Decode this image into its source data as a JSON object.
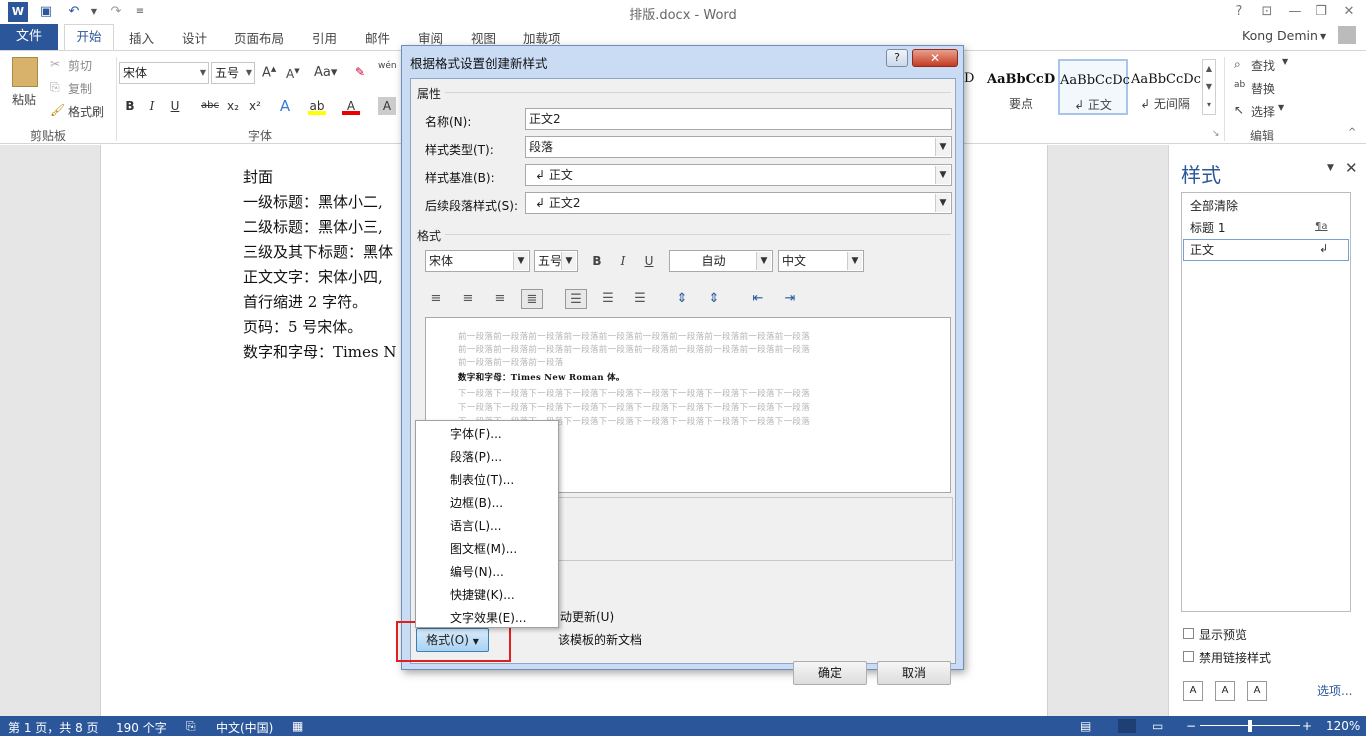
{
  "window": {
    "title": "排版.docx - Word",
    "user": "Kong Demin",
    "qat_undo": "↶",
    "qat_redo": "↷"
  },
  "tabs": [
    "文件",
    "开始",
    "插入",
    "设计",
    "页面布局",
    "引用",
    "邮件",
    "审阅",
    "视图",
    "加载项"
  ],
  "ribbon": {
    "clipboard": {
      "paste": "粘贴",
      "cut": "剪切",
      "copy": "复制",
      "format_painter": "格式刷",
      "group": "剪贴板"
    },
    "font": {
      "font_name": "宋体",
      "font_size": "五号",
      "group": "字体",
      "bold": "B",
      "italic": "I",
      "underline": "U",
      "strike": "abc",
      "sub": "x₂",
      "sup": "x²"
    },
    "styles": [
      {
        "preview": "AaBbCcD",
        "name": "要点"
      },
      {
        "preview": "AaBbCcDc",
        "name": "↲ 正文"
      },
      {
        "preview": "AaBbCcDc",
        "name": "↲ 无间隔"
      }
    ],
    "editing": {
      "find": "查找",
      "replace": "替换",
      "select": "选择",
      "group": "编辑"
    }
  },
  "document": {
    "lines": [
      "封面",
      "一级标题：黑体小二,",
      "二级标题：黑体小三,",
      "三级及其下标题：黑体",
      "正文文字：宋体小四,",
      "首行缩进 2 字符。",
      "页码：5 号宋体。",
      "数字和字母：Times N"
    ]
  },
  "styles_pane": {
    "title": "样式",
    "items": [
      "全部清除",
      "标题 1",
      "正文"
    ],
    "show_preview": "显示预览",
    "disable_linked": "禁用链接样式",
    "options": "选项..."
  },
  "status": {
    "page": "第 1 页，共 8 页",
    "words": "190 个字",
    "lang": "中文(中国)",
    "zoom": "120%"
  },
  "dialog": {
    "title": "根据格式设置创建新样式",
    "properties_label": "属性",
    "name_label": "名称(N):",
    "name_value": "正文2",
    "type_label": "样式类型(T):",
    "type_value": "段落",
    "based_label": "样式基准(B):",
    "based_value": "↲ 正文",
    "next_label": "后续段落样式(S):",
    "next_value": "↲ 正文2",
    "format_label": "格式",
    "font_value": "宋体",
    "size_value": "五号",
    "color_value": "自动",
    "lang_value": "中文",
    "preview_prev": "前一段落前一段落前一段落前一段落前一段落前一段落前一段落前一段落前一段落前一段落",
    "preview_prev_short": "前一段落前一段落前一段落",
    "preview_current": "数字和字母：Times New Roman 体。",
    "preview_next": "下一段落下一段落下一段落下一段落下一段落下一段落下一段落下一段落下一段落下一段落",
    "auto_update_fragment": "动更新(U)",
    "template_fragment": "该模板的新文档",
    "format_button": "格式(O)",
    "ok": "确定",
    "cancel": "取消"
  },
  "format_menu": [
    "字体(F)...",
    "段落(P)...",
    "制表位(T)...",
    "边框(B)...",
    "语言(L)...",
    "图文框(M)...",
    "编号(N)...",
    "快捷键(K)...",
    "文字效果(E)..."
  ]
}
